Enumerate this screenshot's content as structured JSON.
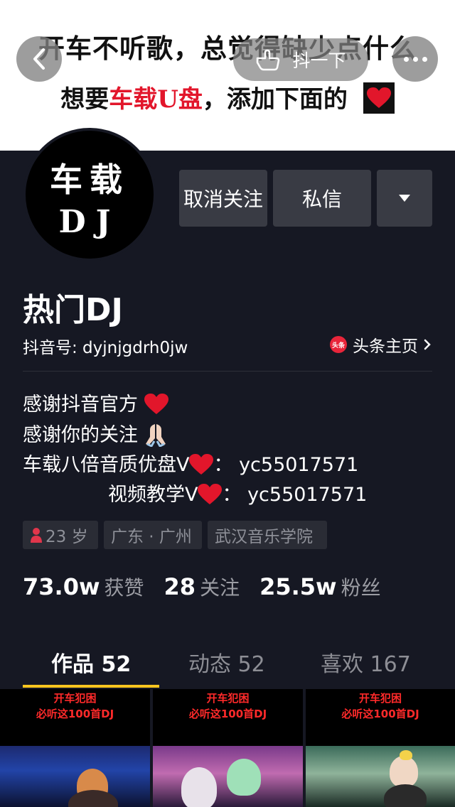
{
  "banner": {
    "line1": "开车不听歌，总觉得缺少点什么",
    "line2_pre": "想要",
    "line2_red": "车载U盘",
    "line2_post": "，添加下面的"
  },
  "top_bar": {
    "douyin_pill_label": "抖一下"
  },
  "avatar": {
    "line1": "车载",
    "line2": "DJ"
  },
  "actions": {
    "unfollow": "取消关注",
    "message": "私信"
  },
  "profile": {
    "nickname": "热门DJ",
    "douyin_id": "抖音号: dyjnjgdrh0jw",
    "toutiao_label": "头条主页",
    "toutiao_logo": "头条"
  },
  "bio": {
    "line1": "感谢抖音官方",
    "line2": "感谢你的关注",
    "line3_pre": "车载八倍音质优盘V",
    "line3_post": "： yc55017571",
    "line4_pre": "视频教学V",
    "line4_post": "： yc55017571"
  },
  "tags": {
    "age": "23 岁",
    "location": "广东 · 广州",
    "school": "武汉音乐学院"
  },
  "stats": {
    "likes_num": "73.0w",
    "likes_label": "获赞",
    "following_num": "28",
    "following_label": "关注",
    "fans_num": "25.5w",
    "fans_label": "粉丝"
  },
  "tabs": {
    "works": "作品 52",
    "dynamic": "动态 52",
    "likes": "喜欢 167"
  },
  "thumbnails": [
    {
      "line1": "开车犯困",
      "line2": "必听这100首DJ"
    },
    {
      "line1": "开车犯困",
      "line2": "必听这100首DJ"
    },
    {
      "line1": "开车犯困",
      "line2": "必听这100首DJ"
    }
  ],
  "colors": {
    "background": "#161823",
    "accent_yellow": "#f9c51f",
    "heart_red": "#e2162b",
    "button_gray": "#393b44"
  },
  "icons": {
    "back": "chevron-left-icon",
    "douyin_pill": "hand-point-icon",
    "more": "more-dots-icon",
    "dropdown": "caret-down-icon",
    "toutiao": "toutiao-logo-icon",
    "age": "person-icon"
  }
}
